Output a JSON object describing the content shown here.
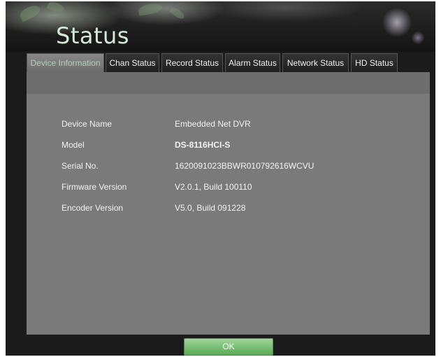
{
  "window": {
    "title": "Status"
  },
  "tabs": [
    {
      "label": "Device Information",
      "active": true
    },
    {
      "label": "Chan Status",
      "active": false
    },
    {
      "label": "Record Status",
      "active": false
    },
    {
      "label": "Alarm Status",
      "active": false
    },
    {
      "label": "Network Status",
      "active": false
    },
    {
      "label": "HD Status",
      "active": false
    }
  ],
  "device_info": [
    {
      "label": "Device Name",
      "value": "Embedded Net DVR"
    },
    {
      "label": "Model",
      "value": "DS-8116HCI-S"
    },
    {
      "label": "Serial No.",
      "value": "1620091023BBWR010792616WCVU"
    },
    {
      "label": "Firmware Version",
      "value": "V2.0.1, Build 100110"
    },
    {
      "label": "Encoder Version",
      "value": "V5.0, Build 091228"
    }
  ],
  "footer": {
    "ok_label": "OK"
  },
  "colors": {
    "accent": "#7dbf79",
    "panel": "#7a7a7a",
    "background": "#1b1b1b"
  }
}
